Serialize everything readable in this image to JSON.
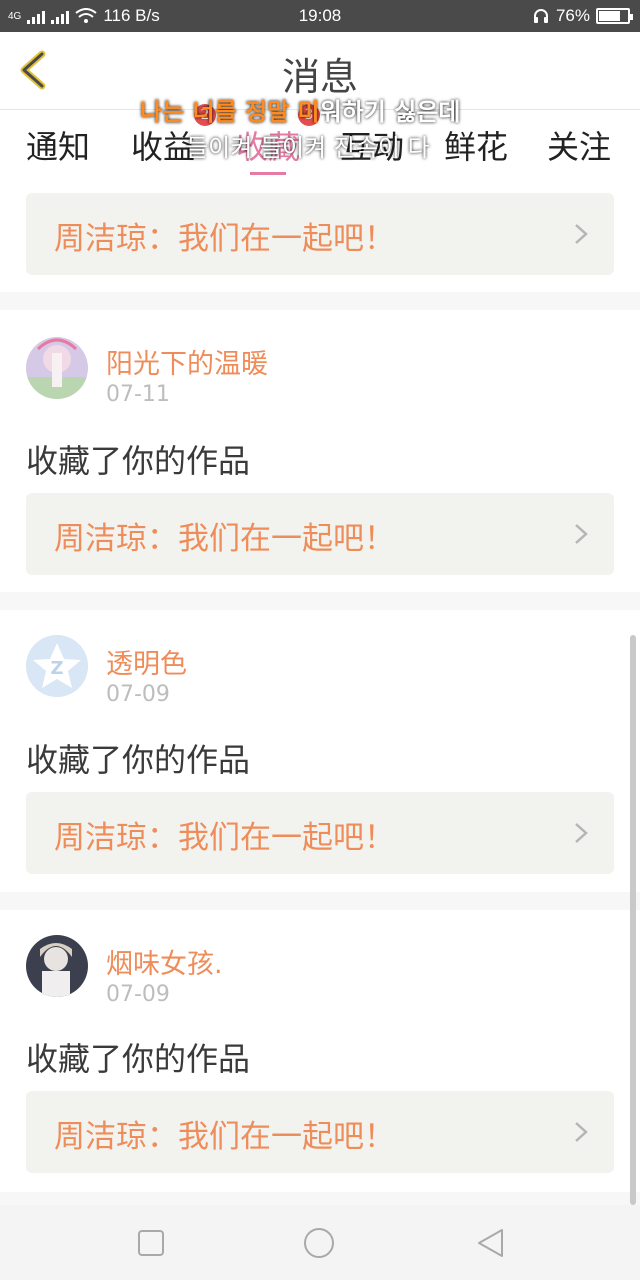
{
  "status": {
    "network": "4G",
    "speed": "116 B/s",
    "time": "19:08",
    "battery": "76%",
    "battery_level": 0.76
  },
  "header": {
    "title": "消息"
  },
  "tabs": [
    {
      "label": "通知"
    },
    {
      "label": "收益",
      "badge": "2"
    },
    {
      "label": "收藏",
      "badge": "3"
    },
    {
      "label": "互动"
    },
    {
      "label": "鲜花"
    },
    {
      "label": "关注"
    }
  ],
  "overlay": {
    "line1_a": "나는 너를 정말 미",
    "line1_b": "워하기 싫은데",
    "line2": "들이켜 들이켜 잔속이 다"
  },
  "top_card": {
    "quote": "周洁琼：我们在一起吧！"
  },
  "items": [
    {
      "name": "阳光下的温暖",
      "date": "07-11",
      "action": "收藏了你的作品",
      "quote": "周洁琼：我们在一起吧！"
    },
    {
      "name": "透明色",
      "date": "07-09",
      "action": "收藏了你的作品",
      "quote": "周洁琼：我们在一起吧！"
    },
    {
      "name": "烟味女孩.",
      "date": "07-09",
      "action": "收藏了你的作品",
      "quote": "周洁琼：我们在一起吧！"
    }
  ],
  "colors": {
    "accent": "#e57aa3",
    "name": "#ef8d5a",
    "quote_bg": "#f2f3ef",
    "badge": "#e64d4d"
  }
}
